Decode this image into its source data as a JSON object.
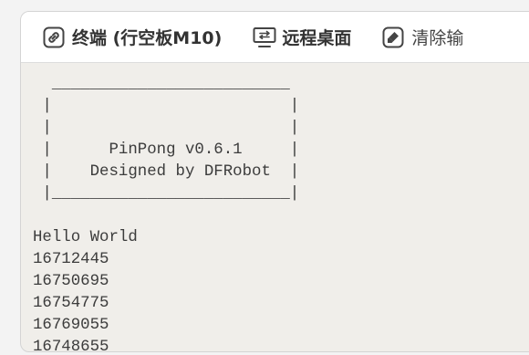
{
  "toolbar": {
    "terminal": {
      "label": "终端 (行空板M10)",
      "icon": "link-icon"
    },
    "remote_desktop": {
      "label": "远程桌面",
      "icon": "monitor-icon"
    },
    "clear_output": {
      "label": "清除输",
      "icon": "eraser-icon"
    }
  },
  "console": {
    "banner_lines": [
      "  _________________________",
      " |                         |",
      " |                         |",
      " |      PinPong v0.6.1     |",
      " |    Designed by DFRobot  |",
      " |_________________________|"
    ],
    "output_lines": [
      "Hello World",
      "16712445",
      "16750695",
      "16754775",
      "16769055",
      "16748655"
    ]
  },
  "colors": {
    "console_bg": "#f0eeea",
    "toolbar_bg": "#ffffff",
    "text": "#3c3c3c",
    "scrollbar_thumb": "#3d7bd6"
  }
}
